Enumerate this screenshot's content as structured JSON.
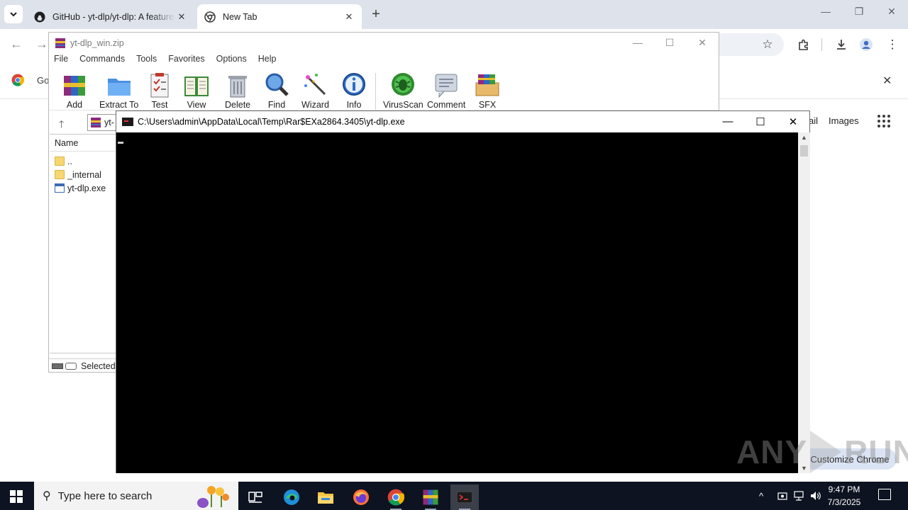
{
  "chrome": {
    "tabs": [
      {
        "title": "GitHub - yt-dlp/yt-dlp: A feature-rich command-line audio/video downloader",
        "icon": "github-icon"
      },
      {
        "title": "New Tab",
        "icon": "chrome-icon"
      }
    ],
    "bookmark_text": "Go",
    "ntp_links": [
      "ail",
      "Images"
    ],
    "customize_label": "Customize Chrome"
  },
  "winrar": {
    "title": "yt-dlp_win.zip",
    "menu": [
      "File",
      "Commands",
      "Tools",
      "Favorites",
      "Options",
      "Help"
    ],
    "toolbar": [
      "Add",
      "Extract To",
      "Test",
      "View",
      "Delete",
      "Find",
      "Wizard",
      "Info",
      "VirusScan",
      "Comment",
      "SFX"
    ],
    "address": "yt-",
    "list_header": "Name",
    "files": [
      {
        "name": "..",
        "type": "folder"
      },
      {
        "name": "_internal",
        "type": "folder"
      },
      {
        "name": "yt-dlp.exe",
        "type": "exe"
      }
    ],
    "status": "Selected"
  },
  "console": {
    "title": "C:\\Users\\admin\\AppData\\Local\\Temp\\Rar$EXa2864.3405\\yt-dlp.exe"
  },
  "watermark": {
    "left": "ANY",
    "right": "RUN"
  },
  "taskbar": {
    "search_placeholder": "Type here to search",
    "time": "9:47 PM",
    "date": "7/3/2025"
  },
  "colors": {
    "chrome_tabstrip": "#dee3eb",
    "taskbar": "#0d1320",
    "console_bg": "#000000"
  }
}
